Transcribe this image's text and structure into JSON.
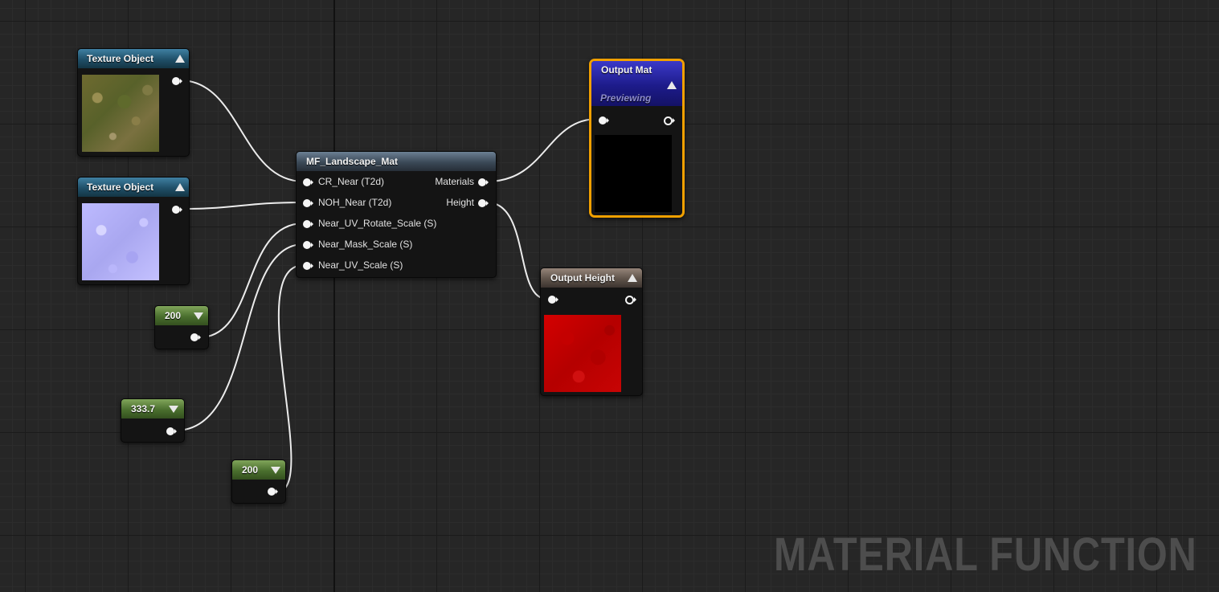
{
  "graph": {
    "watermark": "MATERIAL FUNCTION"
  },
  "nodes": {
    "texture_object_1": {
      "title": "Texture Object",
      "preview": "ground-texture-thumbnail"
    },
    "texture_object_2": {
      "title": "Texture Object",
      "preview": "normal-map-thumbnail"
    },
    "constant_1": {
      "value": "200"
    },
    "constant_2": {
      "value": "333.7"
    },
    "constant_3": {
      "value": "200"
    },
    "material_function": {
      "title": "MF_Landscape_Mat",
      "inputs": [
        "CR_Near (T2d)",
        "NOH_Near (T2d)",
        "Near_UV_Rotate_Scale (S)",
        "Near_Mask_Scale (S)",
        "Near_UV_Scale (S)"
      ],
      "outputs": [
        "Materials",
        "Height"
      ]
    },
    "output_mat": {
      "title": "Output Mat",
      "status": "Previewing",
      "selected": true,
      "highlight_color": "#f0a000"
    },
    "output_height": {
      "title": "Output Height"
    }
  },
  "colors": {
    "texture_header": "#1f4f68",
    "function_header": "#3b4957",
    "constant_header": "#4a6f2e",
    "output_mat_header": "#1d1b8a",
    "output_height_header": "#5f534a",
    "height_preview": "#c80000"
  }
}
